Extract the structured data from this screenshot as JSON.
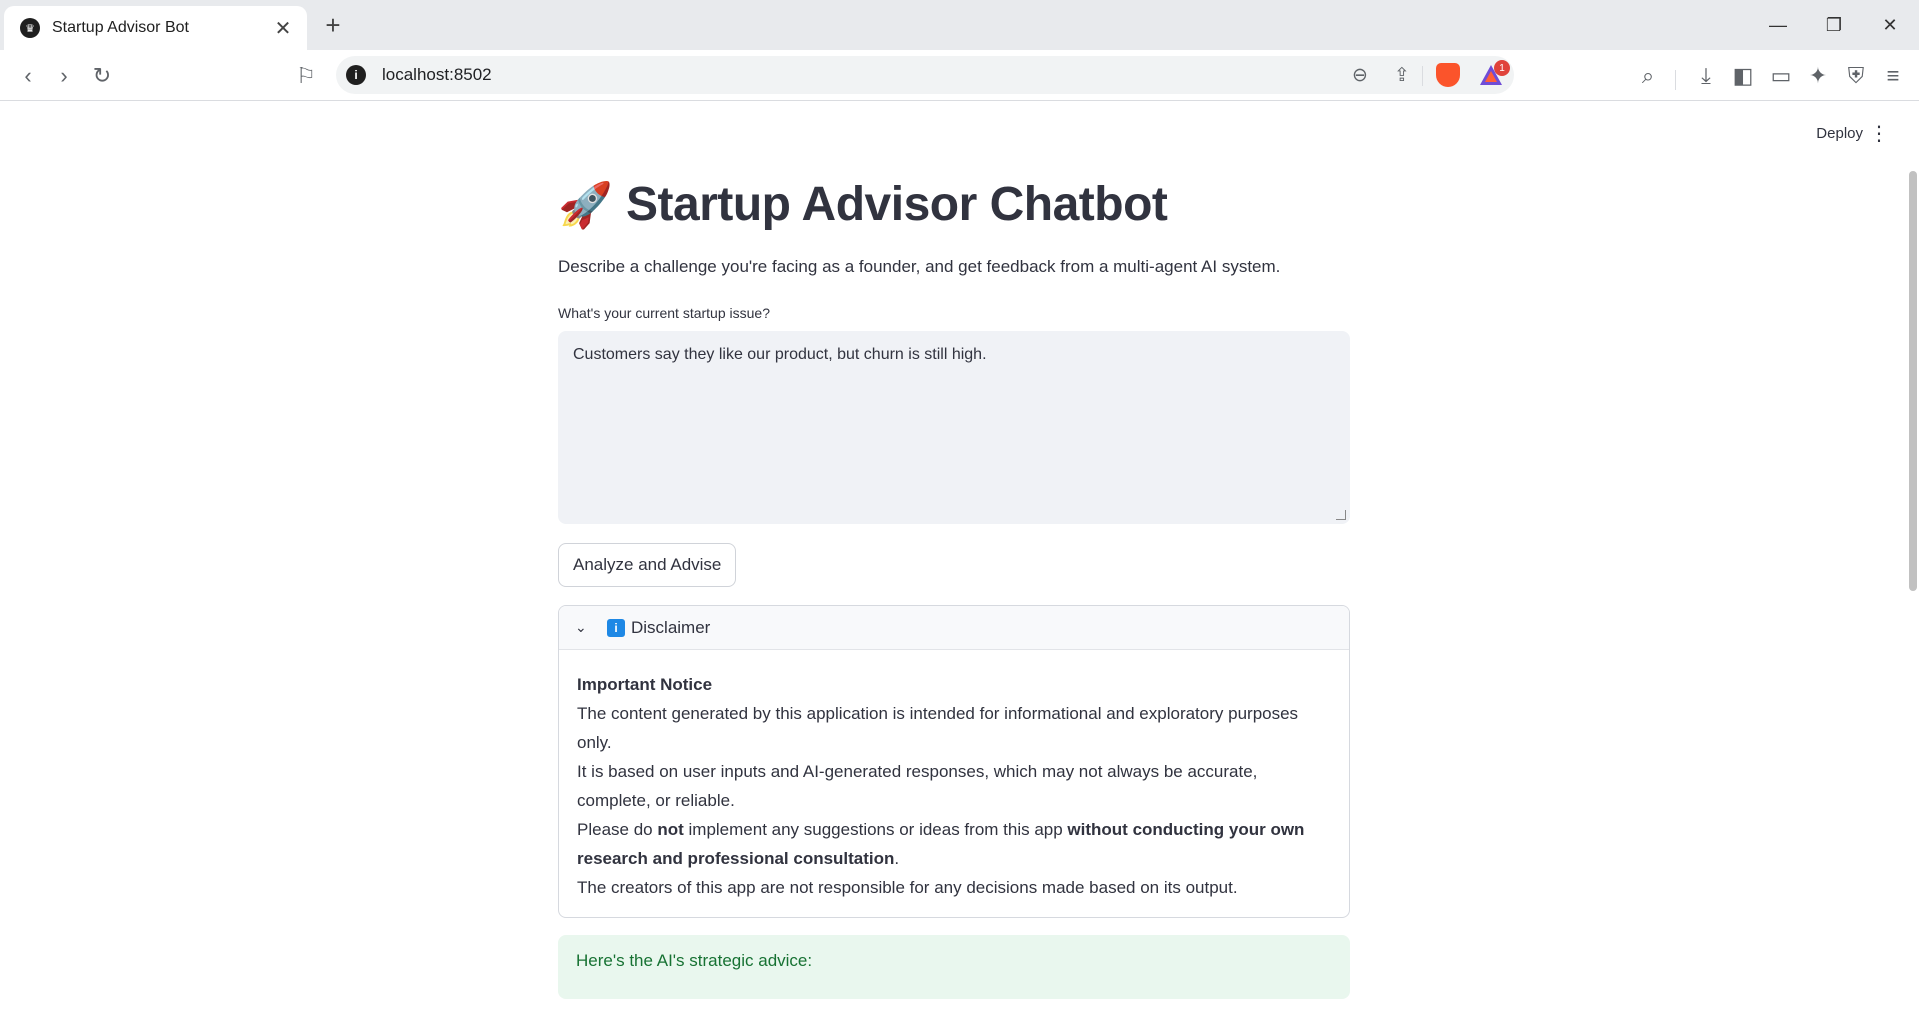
{
  "browser": {
    "tab_title": "Startup Advisor Bot",
    "url": "localhost:8502",
    "rewards_badge": "1"
  },
  "app": {
    "deploy_label": "Deploy",
    "title_emoji": "🚀",
    "title": "Startup Advisor Chatbot",
    "description": "Describe a challenge you're facing as a founder, and get feedback from a multi-agent AI system.",
    "input_label": "What's your current startup issue?",
    "input_value": "Customers say they like our product, but churn is still high.",
    "button_label": "Analyze and Advise",
    "disclaimer": {
      "header": "Disclaimer",
      "heading": "Important Notice",
      "line1": "The content generated by this application is intended for informational and exploratory purposes only.",
      "line2": "It is based on user inputs and AI-generated responses, which may not always be accurate, complete, or reliable.",
      "line3_a": "Please do ",
      "line3_b": "not",
      "line3_c": " implement any suggestions or ideas from this app ",
      "line3_d": "without conducting your own research and professional consultation",
      "line3_e": ".",
      "line4": "The creators of this app are not responsible for any decisions made based on its output."
    },
    "success_text": "Here's the AI's strategic advice:"
  }
}
